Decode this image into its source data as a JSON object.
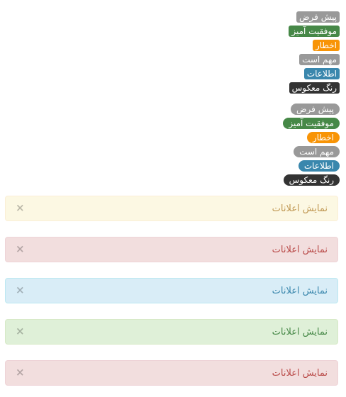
{
  "labels": [
    {
      "text": "پیش فرض",
      "variant": "default"
    },
    {
      "text": "موفقیت آمیز",
      "variant": "success"
    },
    {
      "text": "اخطار",
      "variant": "warning"
    },
    {
      "text": "مهم است",
      "variant": "important"
    },
    {
      "text": "اطلاعات",
      "variant": "info"
    },
    {
      "text": "رنگ معکوس",
      "variant": "inverse"
    }
  ],
  "badges": [
    {
      "text": "پیش فرض",
      "variant": "default"
    },
    {
      "text": "موفقیت آمیز",
      "variant": "success"
    },
    {
      "text": "اخطار",
      "variant": "warning"
    },
    {
      "text": "مهم است",
      "variant": "important"
    },
    {
      "text": "اطلاعات",
      "variant": "info"
    },
    {
      "text": "رنگ معکوس",
      "variant": "inverse"
    }
  ],
  "alerts": [
    {
      "text": "نمایش اعلانات",
      "variant": "warning",
      "close": "×"
    },
    {
      "text": "نمایش اعلانات",
      "variant": "error",
      "close": "×"
    },
    {
      "text": "نمایش اعلانات",
      "variant": "info",
      "close": "×"
    },
    {
      "text": "نمایش اعلانات",
      "variant": "success",
      "close": "×"
    },
    {
      "text": "نمایش اعلانات",
      "variant": "error",
      "close": "×"
    }
  ],
  "colors": {
    "default": "#999999",
    "success": "#468847",
    "warning": "#f89406",
    "important": "#999999",
    "info": "#3a87ad",
    "inverse": "#333333"
  }
}
